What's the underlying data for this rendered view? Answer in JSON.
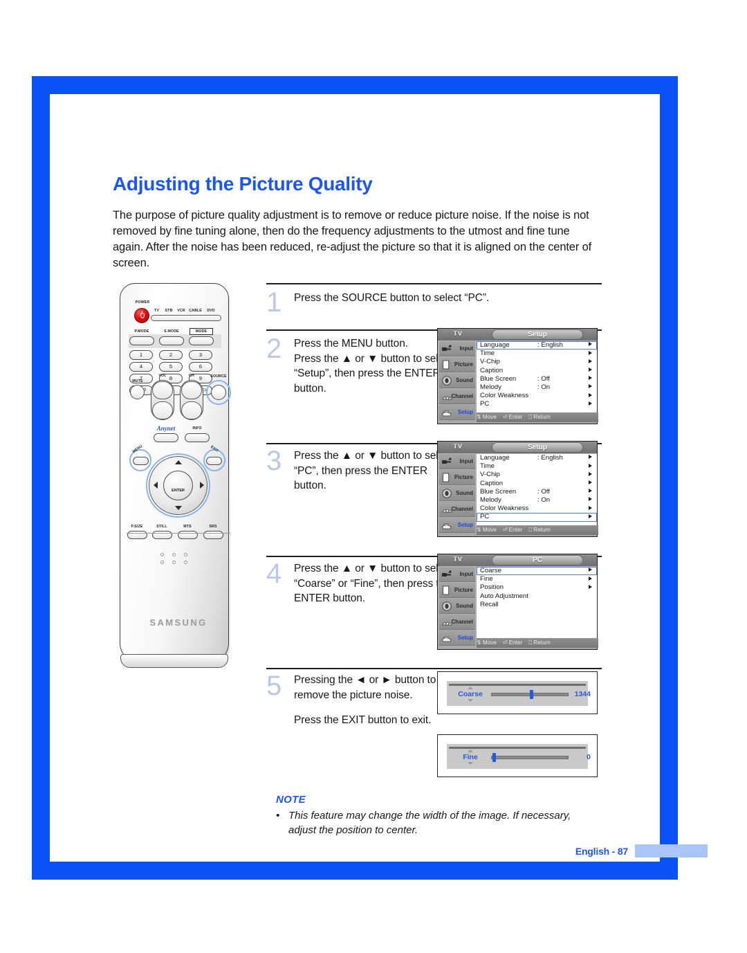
{
  "page": {
    "title": "Adjusting the Picture Quality",
    "intro": "The purpose of picture quality adjustment is to remove or reduce picture noise. If the noise is not removed by fine tuning alone, then do the frequency adjustments to the utmost and fine tune again. After the noise has been reduced, re-adjust the picture so that it is aligned on the center of screen.",
    "accent_color": "#1c56f0",
    "step_number_color": "#b9c7e8"
  },
  "remote": {
    "brand": "SAMSUNG",
    "power_label": "POWER",
    "device_labels": [
      "TV",
      "STB",
      "VCR",
      "CABLE",
      "DVD"
    ],
    "mode_buttons": [
      "P.MODE",
      "S.MODE",
      "MODE"
    ],
    "keypad": [
      "1",
      "2",
      "3",
      "4",
      "5",
      "6",
      "7",
      "8",
      "9",
      "+100",
      "0",
      "PRE-CH"
    ],
    "mute_label": "MUTE",
    "vol_label": "VOL",
    "ch_label": "CH",
    "source_label": "SOURCE",
    "info_label": "INFO",
    "menu_label": "MENU",
    "exit_label": "EXIT",
    "enter_label": "ENTER",
    "script_logo": "Anynet",
    "bottom_buttons": [
      "P.SIZE",
      "STILL",
      "MTS",
      "SRS"
    ]
  },
  "steps": [
    {
      "num": "1",
      "text": "Press the SOURCE button to select “PC”."
    },
    {
      "num": "2",
      "text": "Press the MENU button.\nPress the ▲ or ▼ button to select “Setup”, then press the ENTER button."
    },
    {
      "num": "3",
      "text": "Press the ▲ or ▼ button to select “PC”, then press the ENTER button."
    },
    {
      "num": "4",
      "text": "Press the ▲ or ▼ button to select “Coarse” or “Fine”, then press the ENTER button."
    },
    {
      "num": "5",
      "text": "Pressing the ◄ or ► button to remove the picture noise."
    },
    {
      "num": "",
      "text": "Press the EXIT button to exit."
    }
  ],
  "osd_common": {
    "tv_tab": "TV",
    "sidebar": [
      {
        "label": "Input",
        "icon": "input-jack-icon",
        "selected": false
      },
      {
        "label": "Picture",
        "icon": "picture-icon",
        "selected": false
      },
      {
        "label": "Sound",
        "icon": "speaker-icon",
        "selected": false
      },
      {
        "label": "Channel",
        "icon": "channel-icon",
        "selected": false
      },
      {
        "label": "Setup",
        "icon": "setup-icon",
        "selected": true
      }
    ],
    "status": {
      "move": "Move",
      "enter": "Enter",
      "return": "Return"
    }
  },
  "osd_menus": [
    {
      "title": "Setup",
      "rows": [
        {
          "label": "Language",
          "value": ": English",
          "arrow": true,
          "highlighted": true
        },
        {
          "label": "Time",
          "value": "",
          "arrow": true,
          "highlighted": false
        },
        {
          "label": "V-Chip",
          "value": "",
          "arrow": true,
          "highlighted": false
        },
        {
          "label": "Caption",
          "value": "",
          "arrow": true,
          "highlighted": false
        },
        {
          "label": "Blue Screen",
          "value": ": Off",
          "arrow": true,
          "highlighted": false
        },
        {
          "label": "Melody",
          "value": ": On",
          "arrow": true,
          "highlighted": false
        },
        {
          "label": "Color Weakness",
          "value": "",
          "arrow": true,
          "highlighted": false
        },
        {
          "label": "PC",
          "value": "",
          "arrow": true,
          "highlighted": false
        }
      ]
    },
    {
      "title": "Setup",
      "rows": [
        {
          "label": "Language",
          "value": ": English",
          "arrow": true,
          "highlighted": false
        },
        {
          "label": "Time",
          "value": "",
          "arrow": true,
          "highlighted": false
        },
        {
          "label": "V-Chip",
          "value": "",
          "arrow": true,
          "highlighted": false
        },
        {
          "label": "Caption",
          "value": "",
          "arrow": true,
          "highlighted": false
        },
        {
          "label": "Blue Screen",
          "value": ": Off",
          "arrow": true,
          "highlighted": false
        },
        {
          "label": "Melody",
          "value": ": On",
          "arrow": true,
          "highlighted": false
        },
        {
          "label": "Color Weakness",
          "value": "",
          "arrow": true,
          "highlighted": false
        },
        {
          "label": "PC",
          "value": "",
          "arrow": true,
          "highlighted": true
        }
      ]
    },
    {
      "title": "PC",
      "rows": [
        {
          "label": "Coarse",
          "value": "",
          "arrow": true,
          "highlighted": true
        },
        {
          "label": "Fine",
          "value": "",
          "arrow": true,
          "highlighted": false
        },
        {
          "label": "Position",
          "value": "",
          "arrow": true,
          "highlighted": false
        },
        {
          "label": "Auto Adjustment",
          "value": "",
          "arrow": false,
          "highlighted": false
        },
        {
          "label": "Recall",
          "value": "",
          "arrow": false,
          "highlighted": false
        }
      ]
    }
  ],
  "sliders": [
    {
      "label": "Coarse",
      "value": "1344",
      "fill_percent": 50
    },
    {
      "label": "Fine",
      "value": "0",
      "fill_percent": 2
    }
  ],
  "note": {
    "title": "NOTE",
    "bullet": "•",
    "text": "This feature may change the width of the image. If necessary, adjust the position to center."
  },
  "footer": {
    "page_label": "English - 87"
  }
}
